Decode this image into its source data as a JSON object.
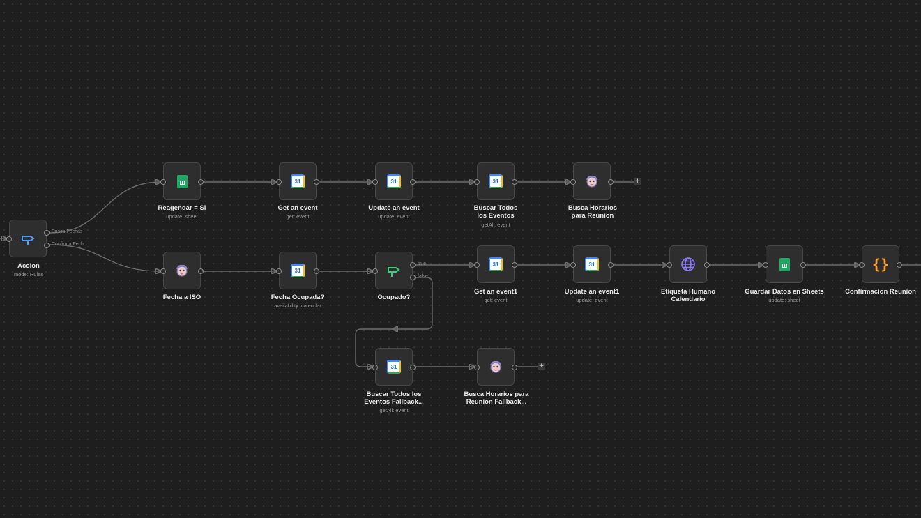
{
  "nodes": {
    "accion": {
      "label": "Accion",
      "sub": "mode: Rules",
      "icon": "switch-icon",
      "out1": "Busca Fechas",
      "out2": "Confirma Fech..."
    },
    "reagendar": {
      "label": "Reagendar = SI",
      "sub": "update: sheet",
      "icon": "google-sheets-icon"
    },
    "get_event": {
      "label": "Get an event",
      "sub": "get: event",
      "icon": "google-calendar-icon",
      "day": "31"
    },
    "update_event": {
      "label": "Update an event",
      "sub": "update: event",
      "icon": "google-calendar-icon",
      "day": "31"
    },
    "buscar_todos": {
      "label": "Buscar Todos los Eventos",
      "sub": "getAll: event",
      "icon": "google-calendar-icon",
      "day": "31"
    },
    "busca_horarios": {
      "label": "Busca Horarios para Reunion",
      "icon": "ai-agent-icon"
    },
    "fecha_iso": {
      "label": "Fecha a ISO",
      "icon": "ai-agent-icon"
    },
    "fecha_ocupada": {
      "label": "Fecha Ocupada?",
      "sub": "availability: calendar",
      "icon": "google-calendar-icon",
      "day": "31"
    },
    "ocupado": {
      "label": "Ocupado?",
      "icon": "if-icon",
      "true_label": "true",
      "false_label": "false"
    },
    "get_event1": {
      "label": "Get an event1",
      "sub": "get: event",
      "icon": "google-calendar-icon",
      "day": "31"
    },
    "update_event1": {
      "label": "Update an event1",
      "sub": "update: event",
      "icon": "google-calendar-icon",
      "day": "31"
    },
    "etiqueta": {
      "label": "Etiqueta Humano Calendario",
      "icon": "globe-icon"
    },
    "guardar": {
      "label": "Guardar Datos en Sheets",
      "sub": "update: sheet",
      "icon": "google-sheets-icon"
    },
    "confirmacion": {
      "label": "Confirmacion Reunion",
      "icon": "code-braces-icon",
      "glyph": "{}"
    },
    "buscar_fallback": {
      "label": "Buscar Todos los Eventos Fallback...",
      "sub": "getAll: event",
      "icon": "google-calendar-icon",
      "day": "31"
    },
    "busca_fallback": {
      "label": "Busca Horarios para Reunion Fallback...",
      "icon": "ai-agent-icon"
    }
  },
  "plus": "+",
  "colors": {
    "canvas": "#1e1e1e",
    "node": "#2e2e2e",
    "switch": "#4f9cf9",
    "if": "#3ecf7b",
    "globe": "#8b7cf6",
    "code": "#ff9d2e",
    "sheets": "#23a566"
  }
}
